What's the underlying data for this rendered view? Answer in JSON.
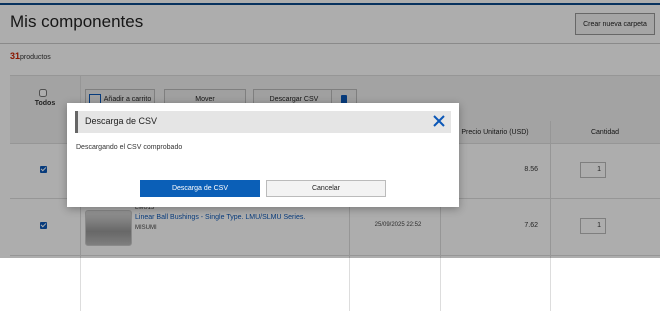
{
  "page": {
    "title": "Mis componentes",
    "new_folder_label": "Crear nueva carpeta",
    "count_number": "31",
    "count_label": "productos"
  },
  "toolbar": {
    "select_all_label": "Todos",
    "add_to_cart_label": "Añadir a carrito",
    "move_label": "Mover",
    "download_csv_label": "Descargar CSV"
  },
  "table": {
    "headers": {
      "unit_price": "Precio Unitario (USD)",
      "quantity": "Cantidad"
    },
    "rows": [
      {
        "checked": true,
        "price": "8.56",
        "quantity": "1"
      },
      {
        "checked": true,
        "part_prefix": "LMU13",
        "name": "Linear Ball Bushings - Single Type. LMU/SLMU Series.",
        "brand": "MISUMI",
        "date": "25/09/2025 22:52",
        "price": "7.62",
        "quantity": "1"
      }
    ]
  },
  "modal": {
    "title": "Descarga de CSV",
    "message": "Descargando el CSV comprobado",
    "primary_label": "Descarga de CSV",
    "cancel_label": "Cancelar"
  },
  "colors": {
    "accent": "#0b5fb7",
    "count": "#cc2200"
  }
}
